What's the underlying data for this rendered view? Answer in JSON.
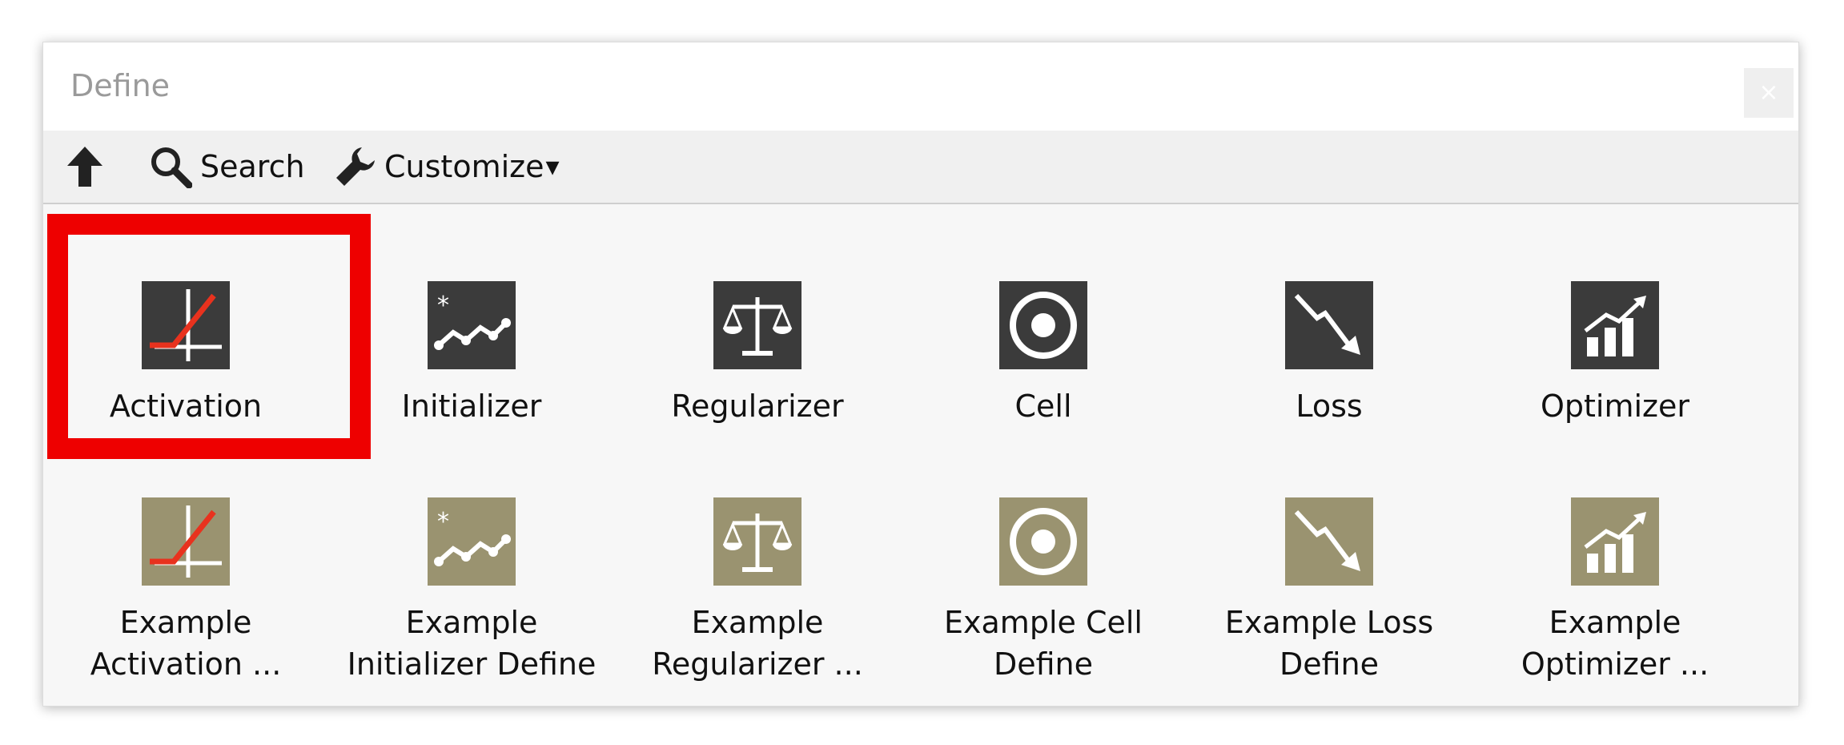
{
  "window": {
    "title": "Define",
    "close_glyph": "×"
  },
  "toolbar": {
    "up_icon": "arrow-up-icon",
    "search_label": "Search",
    "customize_label": "Customize",
    "customize_caret": "▾"
  },
  "items": [
    {
      "label": "Activation",
      "icon": "activation-icon",
      "style": "dark",
      "selected": true
    },
    {
      "label": "Initializer",
      "icon": "initializer-icon",
      "style": "dark"
    },
    {
      "label": "Regularizer",
      "icon": "regularizer-icon",
      "style": "dark"
    },
    {
      "label": "Cell",
      "icon": "cell-icon",
      "style": "dark"
    },
    {
      "label": "Loss",
      "icon": "loss-icon",
      "style": "dark"
    },
    {
      "label": "Optimizer",
      "icon": "optimizer-icon",
      "style": "dark"
    },
    {
      "label_line1": "Example",
      "label_line2": "Activation ...",
      "icon": "activation-icon",
      "style": "olive"
    },
    {
      "label_line1": "Example",
      "label_line2": "Initializer Define",
      "icon": "initializer-icon",
      "style": "olive"
    },
    {
      "label_line1": "Example",
      "label_line2": "Regularizer ...",
      "icon": "regularizer-icon",
      "style": "olive"
    },
    {
      "label_line1": "Example Cell",
      "label_line2": "Define",
      "icon": "cell-icon",
      "style": "olive"
    },
    {
      "label_line1": "Example Loss",
      "label_line2": "Define",
      "icon": "loss-icon",
      "style": "olive"
    },
    {
      "label_line1": "Example",
      "label_line2": "Optimizer ...",
      "icon": "optimizer-icon",
      "style": "olive"
    }
  ],
  "colors": {
    "dark_tile": "#3b3b3b",
    "olive_tile": "#9a9370",
    "selection": "#ee0000",
    "accent_red": "#e8321e"
  }
}
